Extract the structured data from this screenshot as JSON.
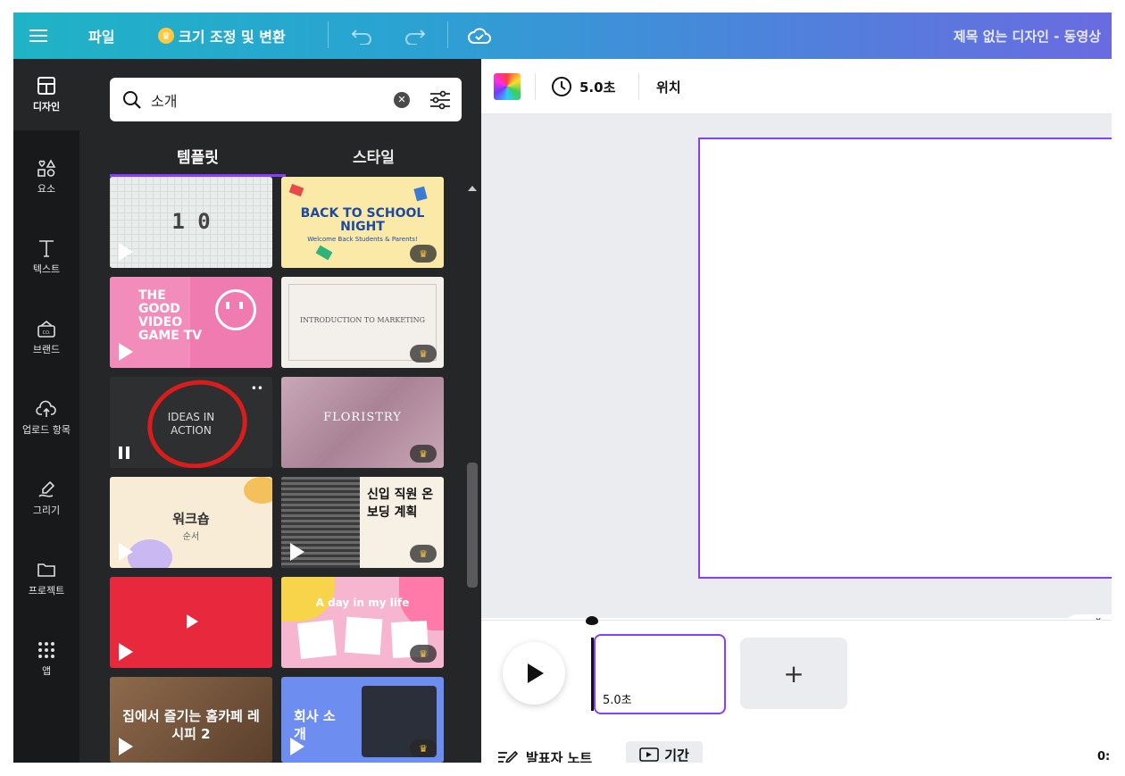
{
  "topbar": {
    "file_label": "파일",
    "resize_label": "크기 조정 및 변환",
    "doc_title": "제목 없는 디자인 - 동영상"
  },
  "rail": {
    "items": [
      {
        "label": "디자인",
        "icon": "layout-icon"
      },
      {
        "label": "요소",
        "icon": "shapes-icon"
      },
      {
        "label": "텍스트",
        "icon": "text-icon"
      },
      {
        "label": "브랜드",
        "icon": "brand-icon"
      },
      {
        "label": "업로드 항목",
        "icon": "upload-cloud-icon"
      },
      {
        "label": "그리기",
        "icon": "draw-icon"
      },
      {
        "label": "프로젝트",
        "icon": "folder-icon"
      },
      {
        "label": "앱",
        "icon": "apps-grid-icon"
      }
    ]
  },
  "panel": {
    "search_value": "소개",
    "tabs": [
      "템플릿",
      "스타일"
    ]
  },
  "templates": [
    {
      "text": "1 0",
      "premium": false
    },
    {
      "text": "BACK TO SCHOOL NIGHT",
      "sub": "Welcome Back Students & Parents!",
      "premium": true
    },
    {
      "text": "THE GOOD VIDEO GAME TV",
      "premium": false
    },
    {
      "text": "INTRODUCTION TO MARKETING",
      "premium": true
    },
    {
      "text": "IDEAS IN ACTION",
      "premium": false
    },
    {
      "text": "FLORISTRY",
      "premium": true
    },
    {
      "text": "워크숍",
      "sub": "순서",
      "premium": false
    },
    {
      "text": "신입 직원 온보딩 계획",
      "premium": true
    },
    {
      "text": "",
      "premium": false
    },
    {
      "text": "A day in my life",
      "premium": true
    },
    {
      "text": "집에서 즐기는 홈카페 레시피 2",
      "premium": false
    },
    {
      "text": "회사 소개",
      "premium": true
    }
  ],
  "toolbar": {
    "duration_label": "5.0초",
    "position_label": "위치"
  },
  "timeline": {
    "clip_duration": "5.0초",
    "add_label": "+",
    "notes_label": "발표자 노트",
    "timing_label": "기간",
    "time_right": "0:"
  },
  "colors": {
    "accent": "#8b3dff",
    "panel_bg": "#252627",
    "rail_bg": "#18191b",
    "canvas_bg": "#ebecf0"
  }
}
